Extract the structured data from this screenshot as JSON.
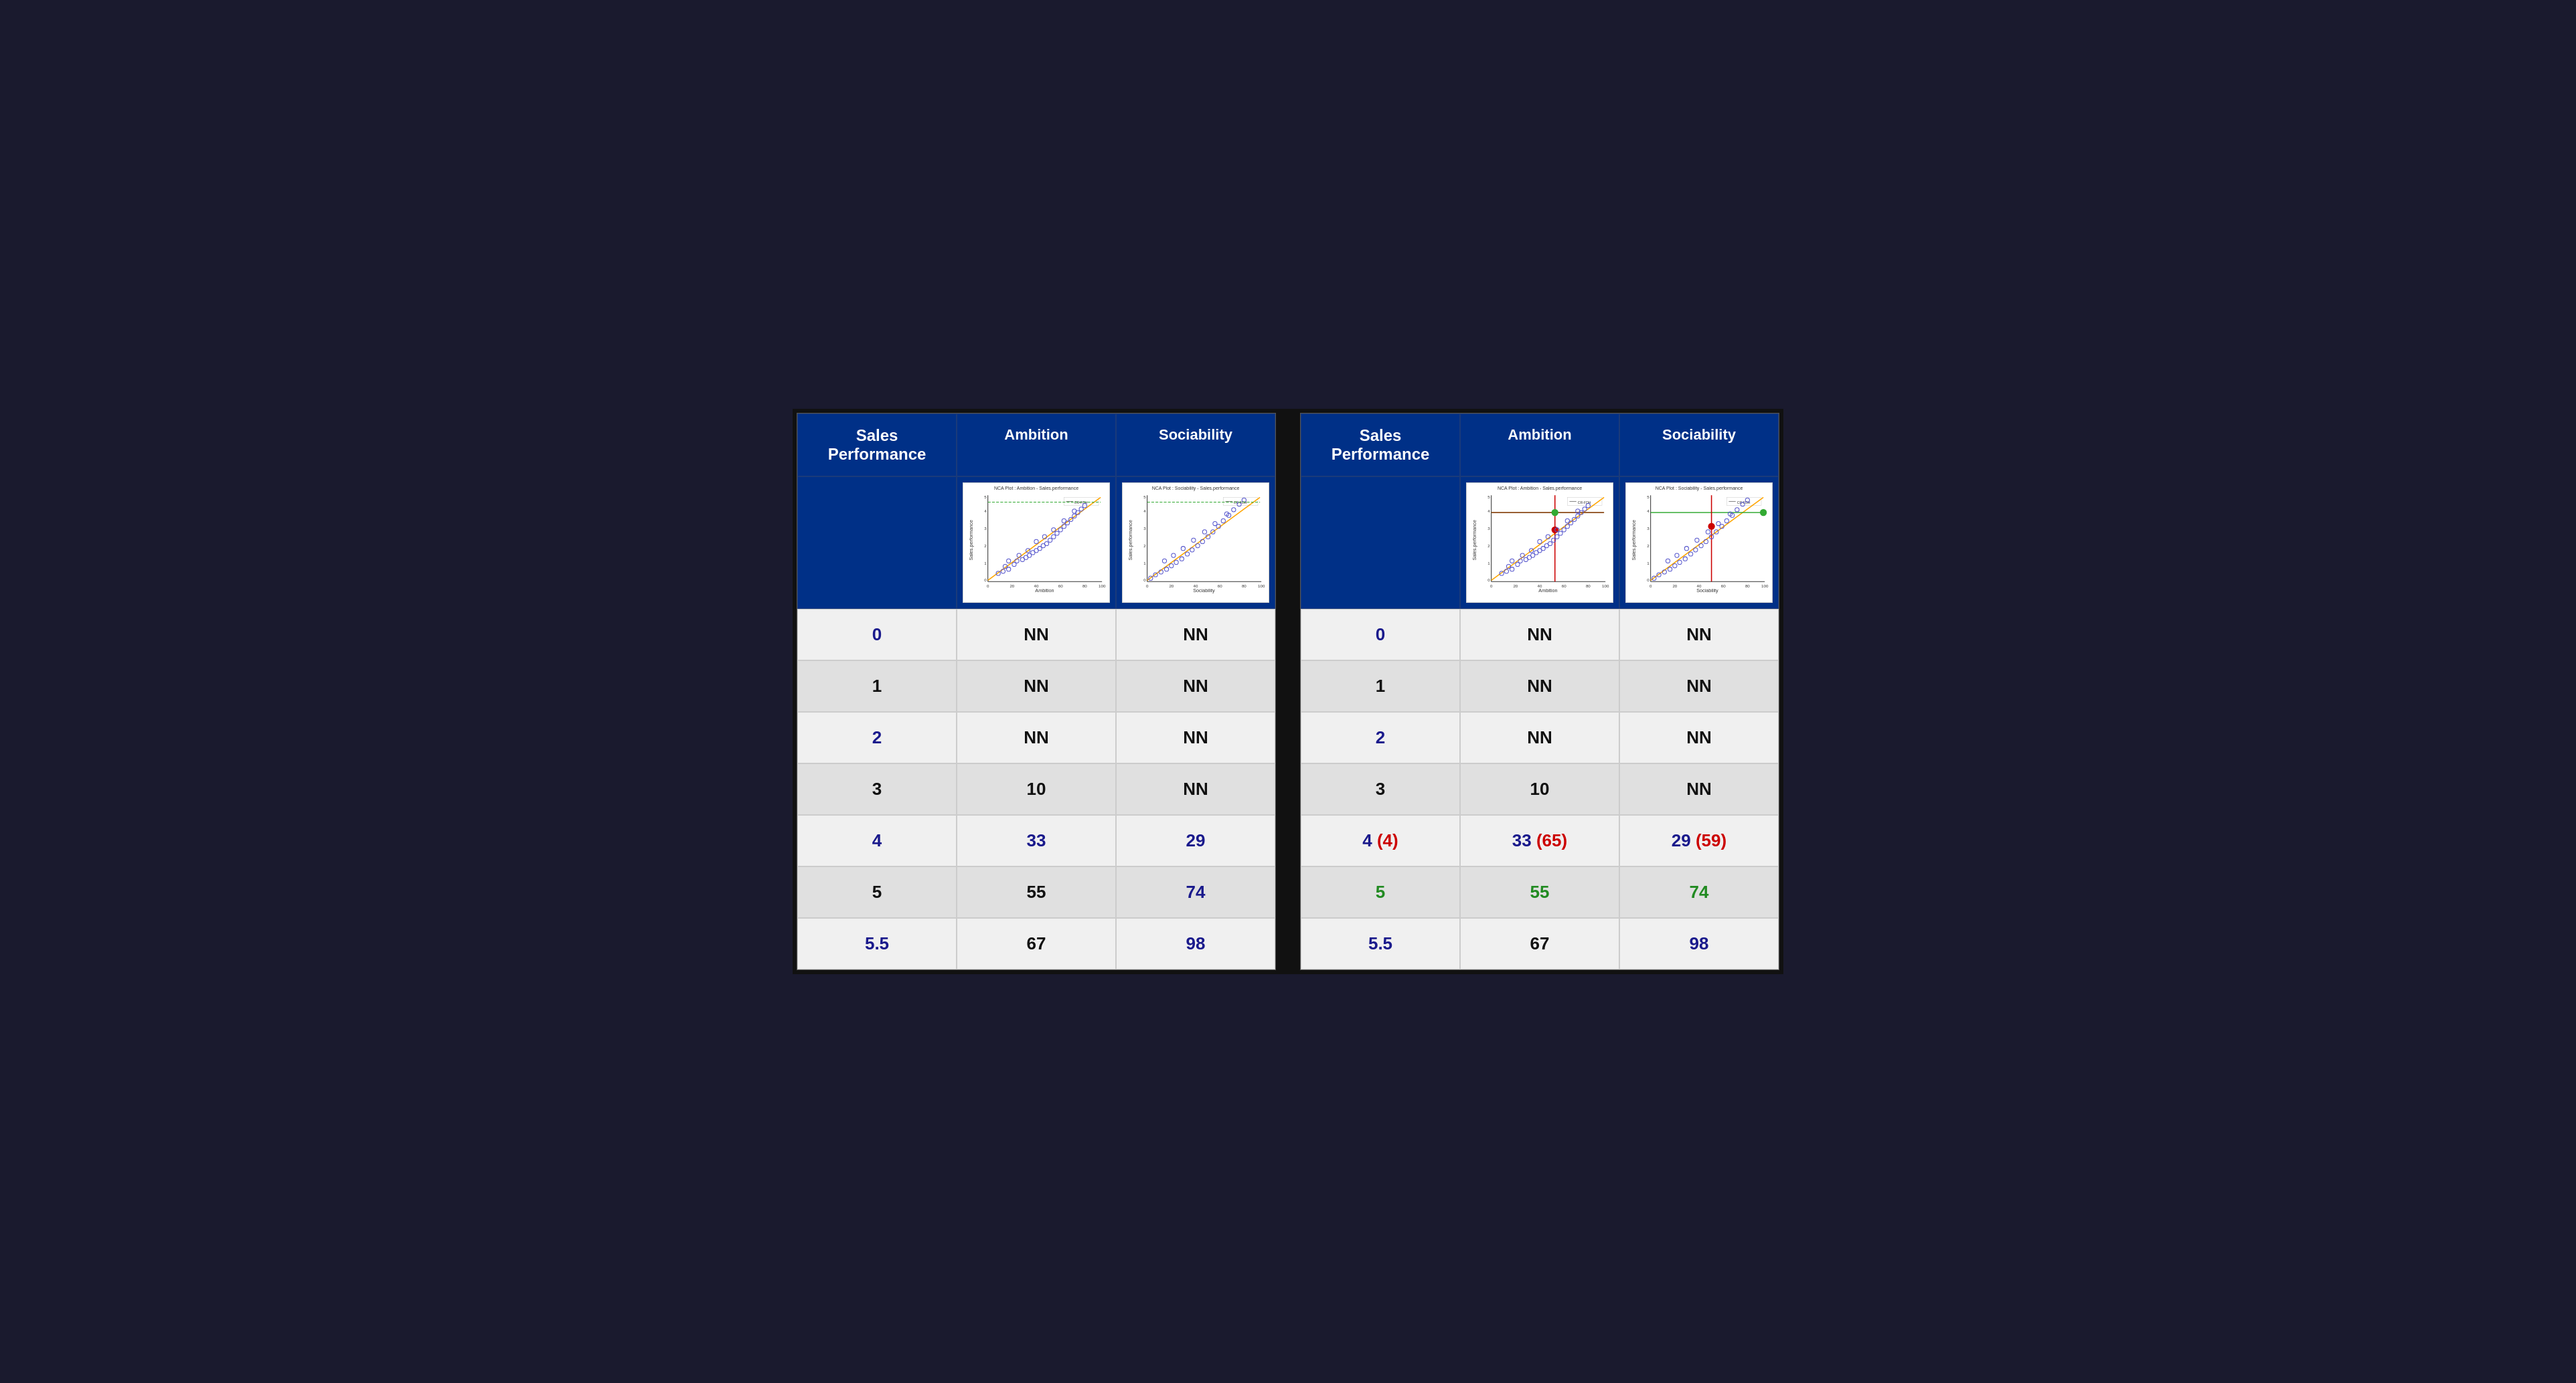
{
  "tables": [
    {
      "id": "left",
      "headers": [
        "Sales\nPerformance",
        "Ambition",
        "Sociability"
      ],
      "chart_left_title": "NCA Plot : Ambition - Sales.performance",
      "chart_right_title": "NCA Plot : Sociability - Sales.performance",
      "rows": [
        {
          "index": "0",
          "index_color": "blue",
          "v1": "NN",
          "v1_color": "black",
          "v2": "NN",
          "v2_color": "black",
          "bg": "light"
        },
        {
          "index": "1",
          "index_color": "black",
          "v1": "NN",
          "v1_color": "black",
          "v2": "NN",
          "v2_color": "black",
          "bg": "medium"
        },
        {
          "index": "2",
          "index_color": "blue",
          "v1": "NN",
          "v1_color": "black",
          "v2": "NN",
          "v2_color": "black",
          "bg": "light"
        },
        {
          "index": "3",
          "index_color": "black",
          "v1": "10",
          "v1_color": "black",
          "v2": "NN",
          "v2_color": "black",
          "bg": "medium"
        },
        {
          "index": "4",
          "index_color": "blue",
          "v1": "33",
          "v1_color": "blue",
          "v2": "29",
          "v2_color": "blue",
          "bg": "light"
        },
        {
          "index": "5",
          "index_color": "black",
          "v1": "55",
          "v1_color": "black",
          "v2": "74",
          "v2_color": "blue",
          "bg": "medium"
        },
        {
          "index": "5.5",
          "index_color": "blue",
          "v1": "67",
          "v1_color": "black",
          "v2": "98",
          "v2_color": "blue",
          "bg": "light"
        }
      ]
    },
    {
      "id": "right",
      "headers": [
        "Sales\nPerformance",
        "Ambition",
        "Sociability"
      ],
      "chart_left_title": "NCA Plot : Ambition - Sales.performance",
      "chart_right_title": "NCA Plot : Sociability - Sales.performance",
      "rows": [
        {
          "index": "0",
          "index_color": "blue",
          "v1": "NN",
          "v1_color": "black",
          "v2": "NN",
          "v2_color": "black",
          "bg": "light"
        },
        {
          "index": "1",
          "index_color": "black",
          "v1": "NN",
          "v1_color": "black",
          "v2": "NN",
          "v2_color": "black",
          "bg": "medium"
        },
        {
          "index": "2",
          "index_color": "blue",
          "v1": "NN",
          "v1_color": "black",
          "v2": "NN",
          "v2_color": "black",
          "bg": "light"
        },
        {
          "index": "3",
          "index_color": "black",
          "v1": "10",
          "v1_color": "black",
          "v2": "NN",
          "v2_color": "black",
          "bg": "medium"
        },
        {
          "index": "4",
          "index_color": "blue",
          "index_extra": "(4)",
          "index_extra_color": "red",
          "v1": "33",
          "v1_color": "blue",
          "v1_extra": "(65)",
          "v1_extra_color": "red",
          "v2": "29",
          "v2_color": "blue",
          "v2_extra": "(59)",
          "v2_extra_color": "red",
          "bg": "light"
        },
        {
          "index": "5",
          "index_color": "green",
          "v1": "55",
          "v1_color": "green",
          "v2": "74",
          "v2_color": "green",
          "bg": "medium"
        },
        {
          "index": "5.5",
          "index_color": "blue",
          "v1": "67",
          "v1_color": "black",
          "v2": "98",
          "v2_color": "blue",
          "bg": "light"
        }
      ]
    }
  ]
}
